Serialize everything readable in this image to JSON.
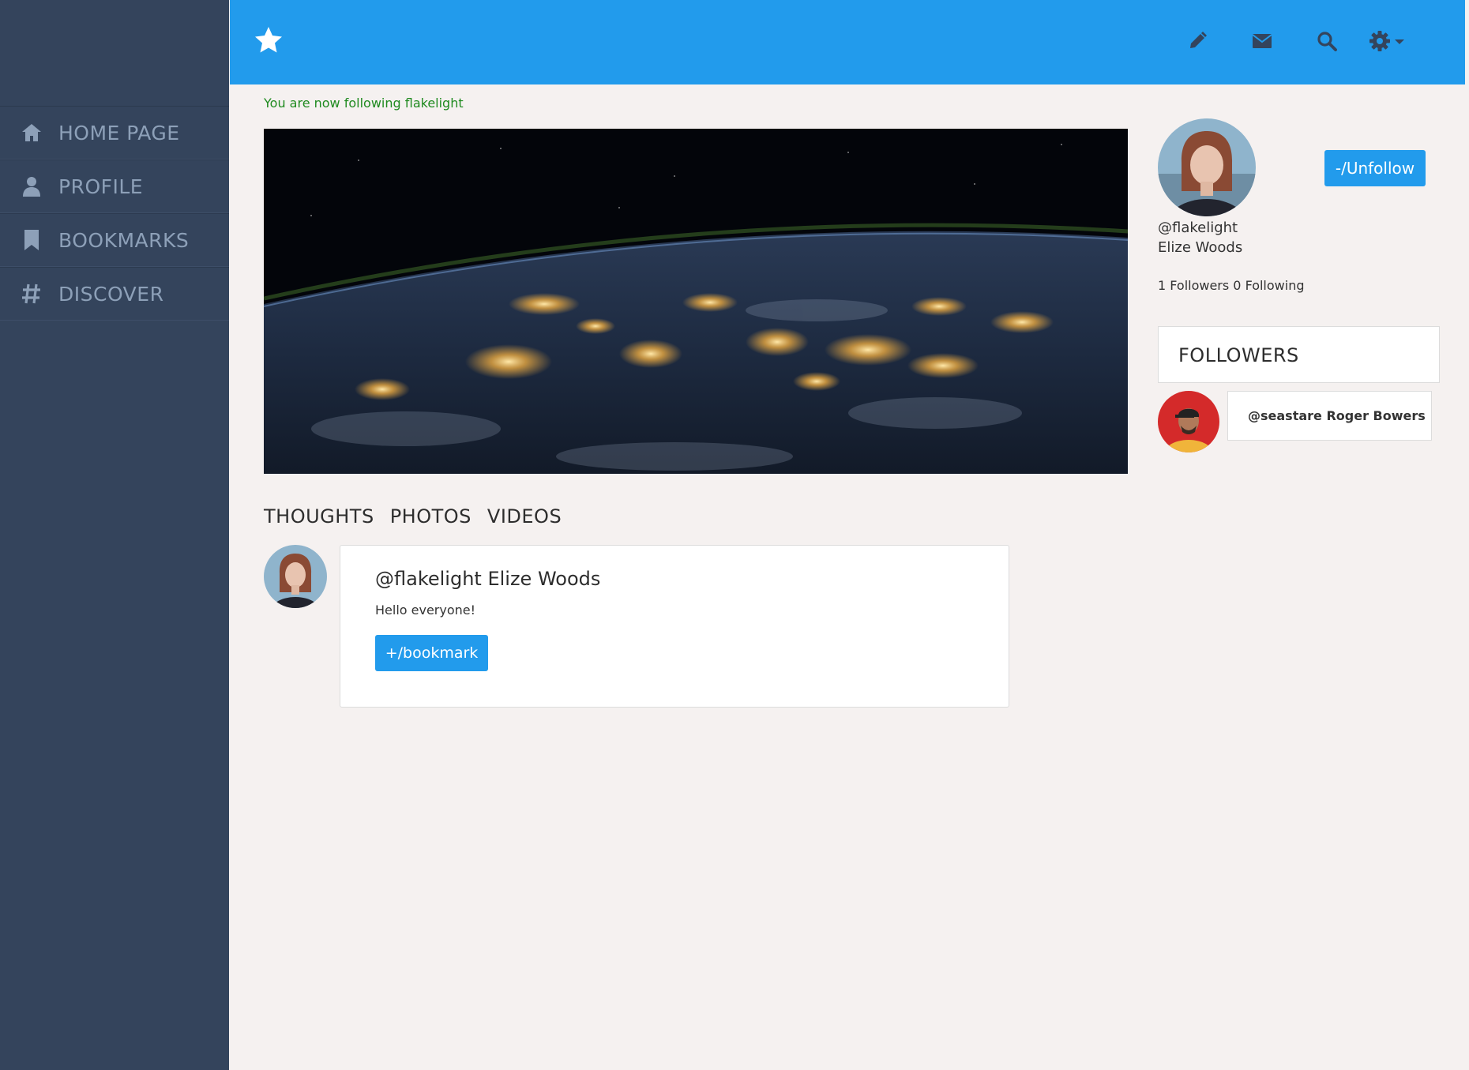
{
  "sidebar": {
    "items": [
      {
        "label": "HOME PAGE",
        "icon": "home-icon"
      },
      {
        "label": "PROFILE",
        "icon": "user-icon"
      },
      {
        "label": "BOOKMARKS",
        "icon": "bookmark-icon"
      },
      {
        "label": "DISCOVER",
        "icon": "hash-icon"
      }
    ]
  },
  "topbar": {
    "brand_icon": "star-icon",
    "actions": [
      "pencil-icon",
      "envelope-icon",
      "search-icon",
      "gear-icon"
    ]
  },
  "flash": {
    "message": "You are now following flakelight"
  },
  "tabs": [
    "THOUGHTS",
    "PHOTOS",
    "VIDEOS"
  ],
  "post": {
    "author": "@flakelight Elize Woods",
    "text": "Hello everyone!",
    "bookmark_label": "+/bookmark"
  },
  "profile": {
    "handle": "@flakelight",
    "name": "Elize Woods",
    "counts": "1 Followers 0 Following",
    "unfollow_label": "-/Unfollow"
  },
  "followers": {
    "title": "FOLLOWERS",
    "items": [
      {
        "label": "@seastare Roger Bowers"
      }
    ]
  },
  "colors": {
    "accent": "#229bec",
    "sidebar": "#34445c",
    "background": "#f5f1f0",
    "flash": "#1f8a1f"
  }
}
